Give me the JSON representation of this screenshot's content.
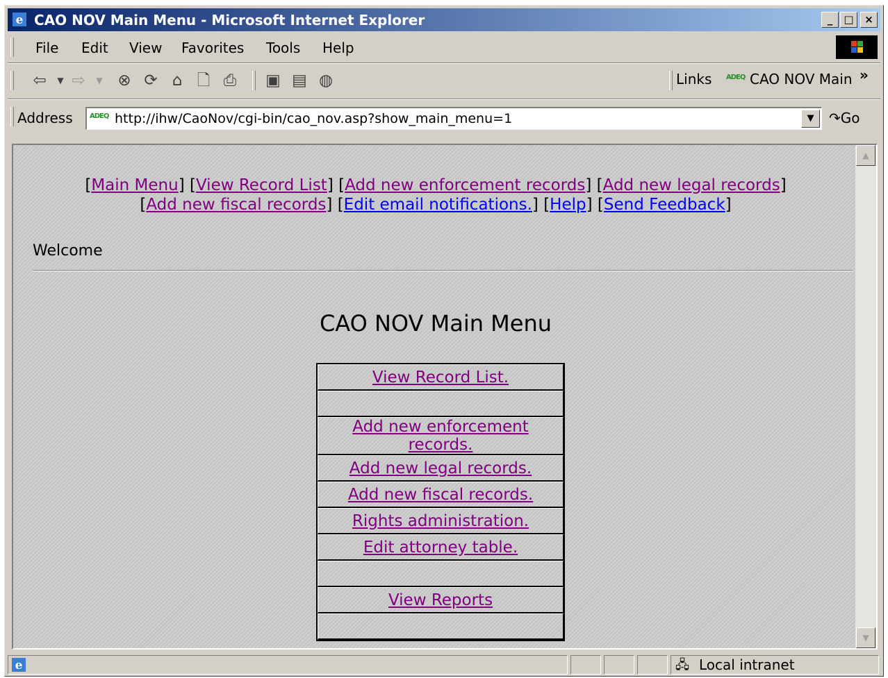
{
  "window": {
    "title": "CAO NOV Main Menu - Microsoft Internet Explorer"
  },
  "menubar": {
    "items": [
      "File",
      "Edit",
      "View",
      "Favorites",
      "Tools",
      "Help"
    ]
  },
  "toolbar": {
    "links_label": "Links",
    "link_item": "CAO NOV Main",
    "more_chevron": "»"
  },
  "address": {
    "label": "Address",
    "url": "http://ihw/CaoNov/cgi-bin/cao_nov.asp?show_main_menu=1",
    "go_label": "Go",
    "site_icon_text": "ADEQ"
  },
  "nav": {
    "row1": [
      "Main Menu",
      "View Record List",
      "Add new enforcement records",
      "Add new legal records"
    ],
    "row2": [
      "Add new fiscal records",
      "Edit email notifications.",
      "Help",
      "Send Feedback"
    ]
  },
  "page": {
    "welcome": "Welcome",
    "title": "CAO NOV Main Menu",
    "menu": [
      "View Record List.",
      "",
      "Add new enforcement records.",
      "Add new legal records.",
      "Add new fiscal records.",
      "Rights administration.",
      "Edit attorney table.",
      "",
      "View Reports",
      ""
    ]
  },
  "status": {
    "zone": "Local intranet"
  },
  "colors": {
    "visited_link": "#800080",
    "link": "#0000ff",
    "title_gradient_start": "#0a246a",
    "title_gradient_end": "#a6caf0",
    "chrome": "#d4d0c8"
  }
}
